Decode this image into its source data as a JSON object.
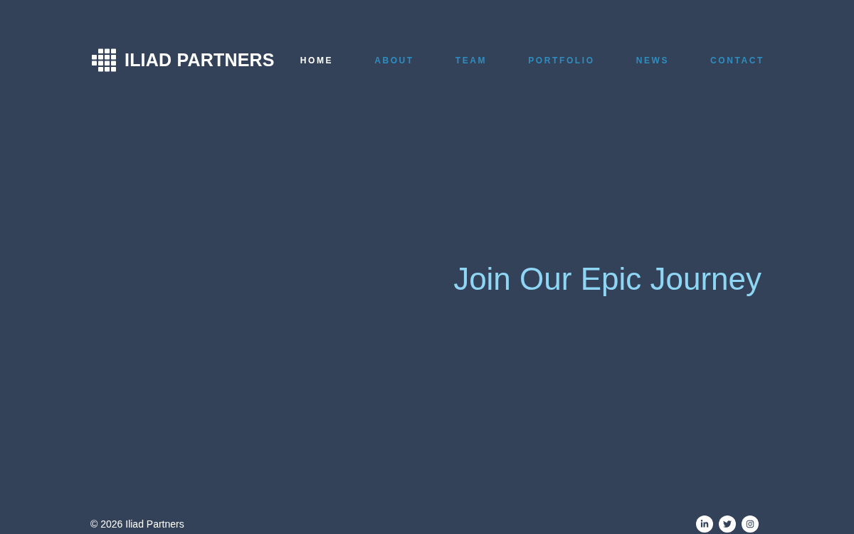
{
  "header": {
    "logo": {
      "text": "ILIAD PARTNERS"
    },
    "nav": {
      "items": [
        {
          "label": "HOME",
          "selected": true
        },
        {
          "label": "ABOUT",
          "selected": false
        },
        {
          "label": "TEAM",
          "selected": false
        },
        {
          "label": "PORTFOLIO",
          "selected": false
        },
        {
          "label": "NEWS",
          "selected": false
        },
        {
          "label": "CONTACT",
          "selected": false
        }
      ]
    }
  },
  "hero": {
    "heading": "Join Our Epic Journey"
  },
  "footer": {
    "copyright": "© 2026 Iliad Partners",
    "social": [
      {
        "kind": "linkedin"
      },
      {
        "kind": "twitter"
      },
      {
        "kind": "instagram"
      }
    ]
  }
}
